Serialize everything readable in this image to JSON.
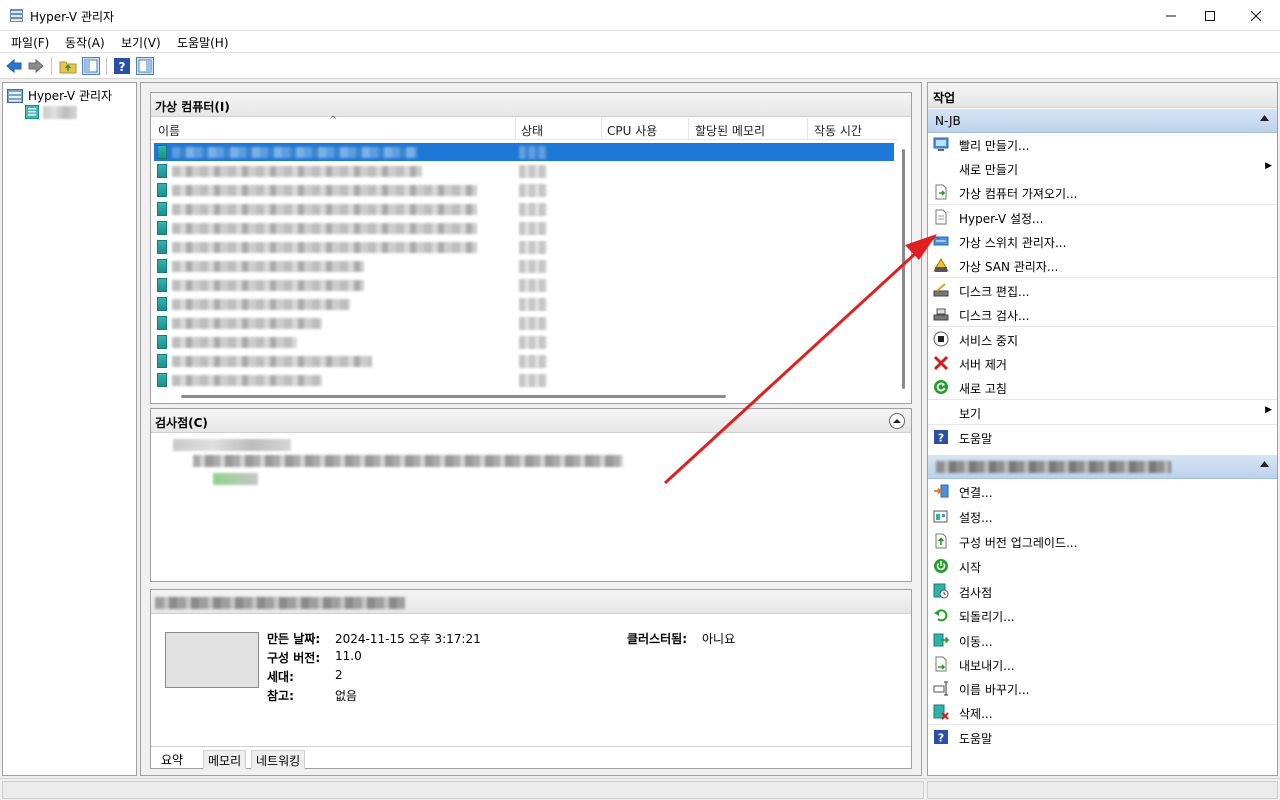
{
  "window": {
    "title": "Hyper-V 관리자"
  },
  "menu": [
    "파일(F)",
    "동작(A)",
    "보기(V)",
    "도움말(H)"
  ],
  "tree": {
    "root": "Hyper-V 관리자"
  },
  "vm_list": {
    "title": "가상 컴퓨터(I)",
    "columns": [
      "이름",
      "상태",
      "CPU 사용",
      "할당된 메모리",
      "작동 시간"
    ]
  },
  "checkpoint": {
    "title": "검사점(C)"
  },
  "details": {
    "created_label": "만든 날짜:",
    "created_value": "2024-11-15 오후 3:17:21",
    "config_label": "구성 버전:",
    "config_value": "11.0",
    "gen_label": "세대:",
    "gen_value": "2",
    "notes_label": "참고:",
    "notes_value": "없음",
    "cluster_label": "클러스터됨:",
    "cluster_value": "아니요",
    "tabs": [
      "요약",
      "메모리",
      "네트워킹"
    ]
  },
  "actions": {
    "title": "작업",
    "server_group": "N-JB",
    "server_actions": [
      {
        "label": "빨리 만들기...",
        "icon": "quick-create-icon"
      },
      {
        "label": "새로 만들기",
        "icon": "",
        "submenu": true
      },
      {
        "label": "가상 컴퓨터 가져오기...",
        "icon": "import-icon"
      },
      {
        "label": "Hyper-V 설정...",
        "icon": "settings-doc-icon"
      },
      {
        "label": "가상 스위치 관리자...",
        "icon": "switch-icon"
      },
      {
        "label": "가상 SAN 관리자...",
        "icon": "san-icon"
      },
      {
        "label": "디스크 편집...",
        "icon": "edit-disk-icon"
      },
      {
        "label": "디스크 검사...",
        "icon": "inspect-disk-icon"
      },
      {
        "label": "서비스 중지",
        "icon": "stop-icon"
      },
      {
        "label": "서버 제거",
        "icon": "remove-icon"
      },
      {
        "label": "새로 고침",
        "icon": "refresh-icon"
      },
      {
        "label": "보기",
        "icon": "",
        "submenu": true
      },
      {
        "label": "도움말",
        "icon": "help-icon"
      }
    ],
    "vm_actions": [
      {
        "label": "연결...",
        "icon": "connect-icon"
      },
      {
        "label": "설정...",
        "icon": "settings-icon"
      },
      {
        "label": "구성 버전 업그레이드...",
        "icon": "upgrade-icon"
      },
      {
        "label": "시작",
        "icon": "start-icon"
      },
      {
        "label": "검사점",
        "icon": "checkpoint-icon"
      },
      {
        "label": "되돌리기...",
        "icon": "revert-icon"
      },
      {
        "label": "이동...",
        "icon": "move-icon"
      },
      {
        "label": "내보내기...",
        "icon": "export-icon"
      },
      {
        "label": "이름 바꾸기...",
        "icon": "rename-icon"
      },
      {
        "label": "삭제...",
        "icon": "delete-icon"
      },
      {
        "label": "도움말",
        "icon": "help-icon"
      }
    ]
  },
  "colors": {
    "selection": "#1e78d7",
    "arrow": "#e02020",
    "group_header": "#c6d9ef"
  }
}
